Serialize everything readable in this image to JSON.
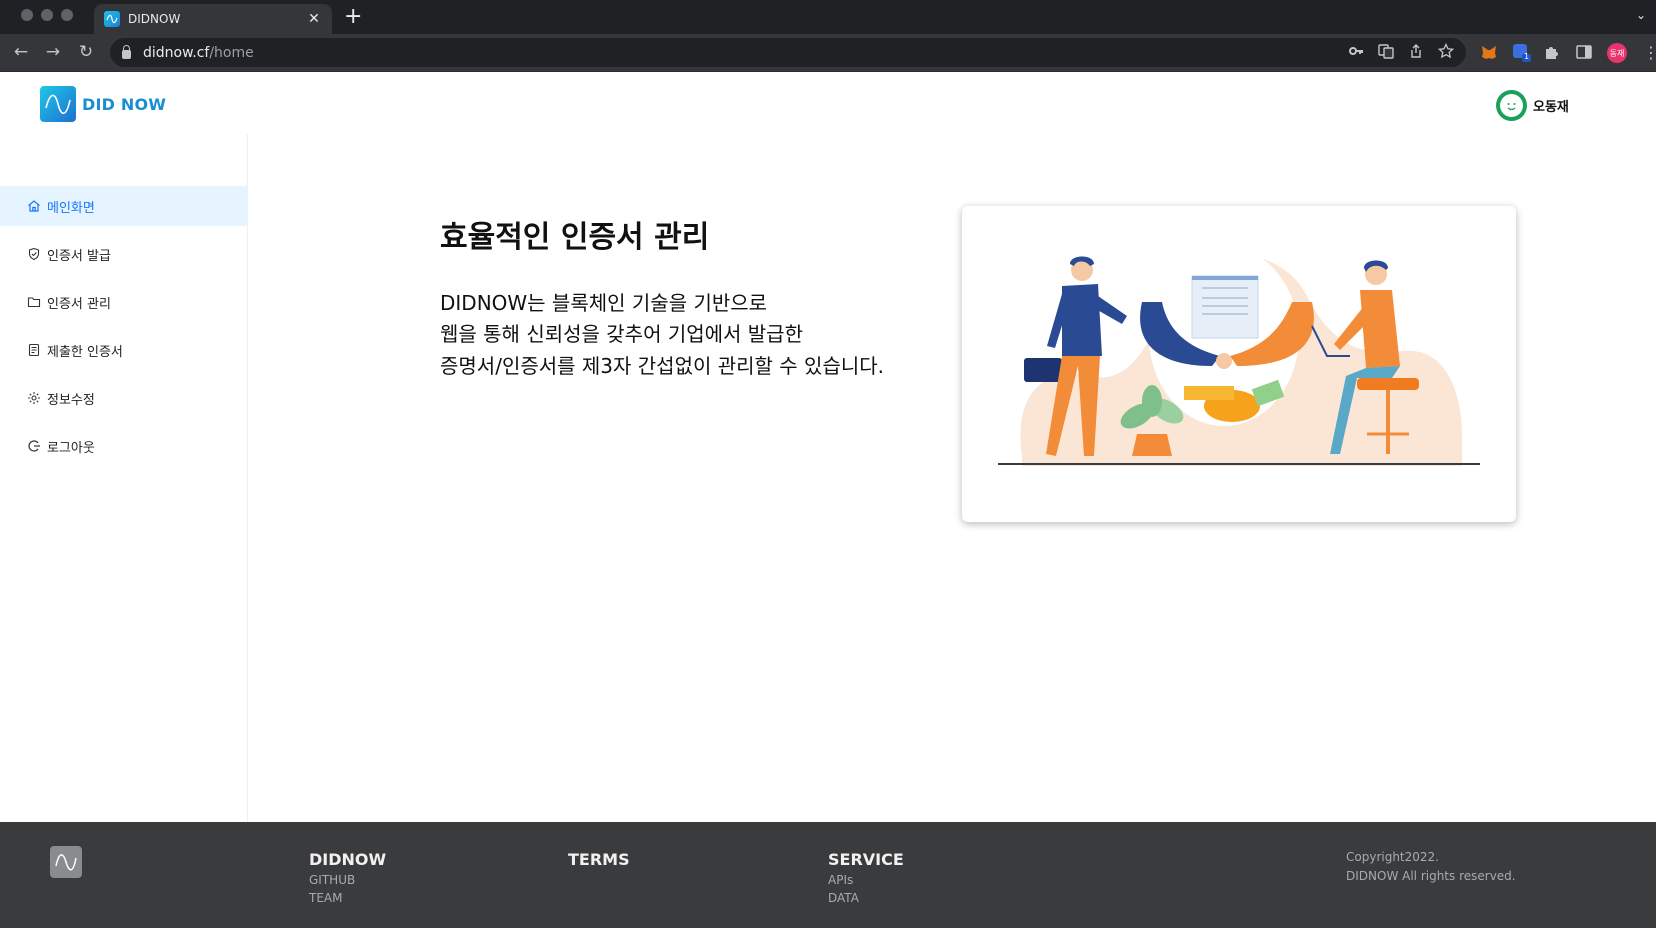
{
  "browser": {
    "tab_title": "DIDNOW",
    "url_host": "didnow.cf",
    "url_path": "/home",
    "profile_initials": "동재",
    "extension_badge": "1"
  },
  "header": {
    "logo_text": "DID NOW",
    "user_name": "오동재"
  },
  "sidebar": {
    "items": [
      {
        "label": "메인화면",
        "icon": "home-icon"
      },
      {
        "label": "인증서 발급",
        "icon": "shield-check-icon"
      },
      {
        "label": "인증서 관리",
        "icon": "folder-icon"
      },
      {
        "label": "제출한 인증서",
        "icon": "document-icon"
      },
      {
        "label": "정보수정",
        "icon": "gear-icon"
      },
      {
        "label": "로그아웃",
        "icon": "logout-icon"
      }
    ]
  },
  "main": {
    "title": "효율적인 인증서 관리",
    "lines": [
      "DIDNOW는 블록체인 기술을 기반으로",
      "웹을 통해 신뢰성을 갖추어 기업에서 발급한",
      "증명서/인증서를 제3자 간섭없이 관리할 수 있습니다."
    ]
  },
  "footer": {
    "col1": {
      "title": "DIDNOW",
      "links": [
        "GITHUB",
        "TEAM"
      ]
    },
    "col2": {
      "title": "TERMS"
    },
    "col3": {
      "title": "SERVICE",
      "links": [
        "APIs",
        "DATA"
      ]
    },
    "copyright_line1": "Copyright2022.",
    "copyright_line2": "DIDNOW All rights reserved."
  },
  "colors": {
    "accent": "#1677ff",
    "active_bg": "#e6f4ff",
    "footer_bg": "#3a3b3d",
    "logo_text": "#1a8fd0"
  }
}
